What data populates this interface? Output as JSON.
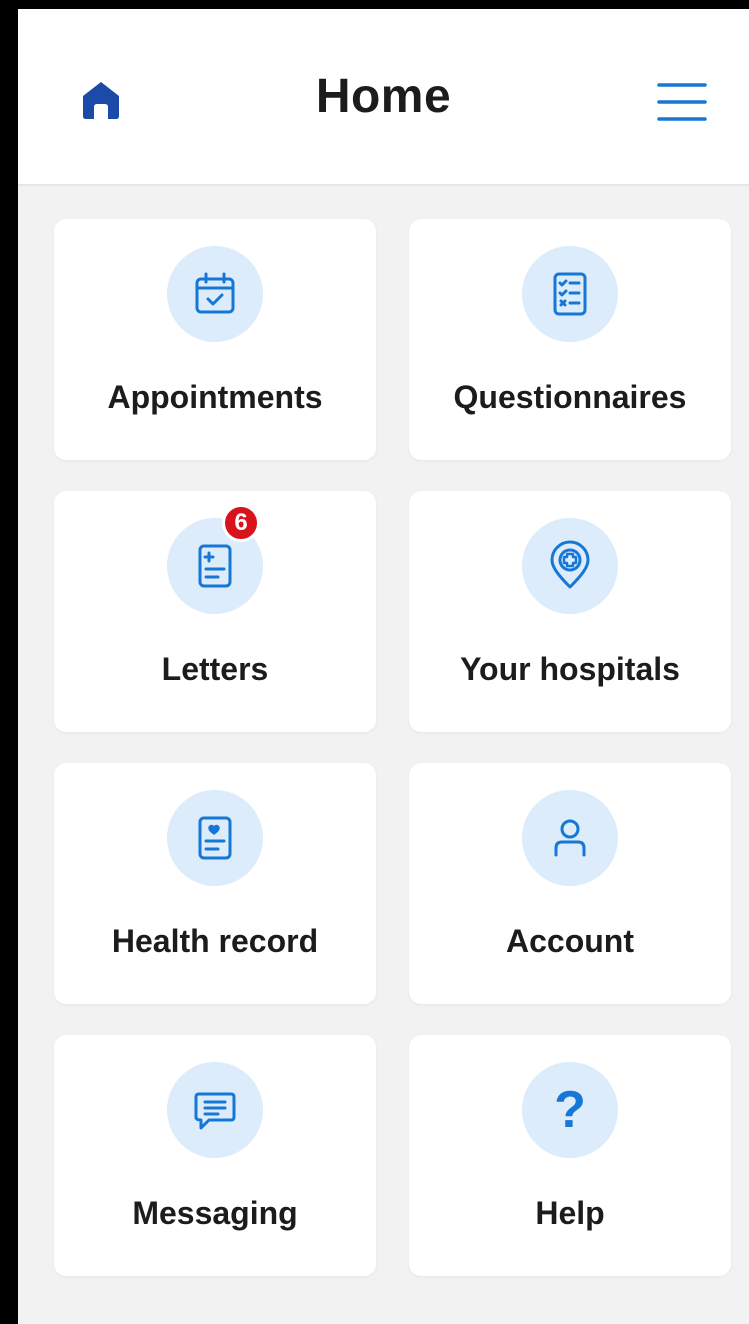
{
  "header": {
    "title": "Home",
    "home_icon": "home-icon",
    "menu_icon": "menu-icon"
  },
  "colors": {
    "accent": "#1677d6",
    "icon_bg": "#dcecfa",
    "badge": "#d9131c",
    "header_icon": "#1b4aa8"
  },
  "tiles": [
    {
      "label": "Appointments",
      "icon": "calendar-icon"
    },
    {
      "label": "Questionnaires",
      "icon": "checklist-icon"
    },
    {
      "label": "Letters",
      "icon": "letter-icon",
      "badge": "6"
    },
    {
      "label": "Your hospitals",
      "icon": "hospital-pin-icon"
    },
    {
      "label": "Health record",
      "icon": "health-record-icon"
    },
    {
      "label": "Account",
      "icon": "person-icon"
    },
    {
      "label": "Messaging",
      "icon": "message-icon"
    },
    {
      "label": "Help",
      "icon": "help-icon",
      "glyph": "?"
    }
  ]
}
